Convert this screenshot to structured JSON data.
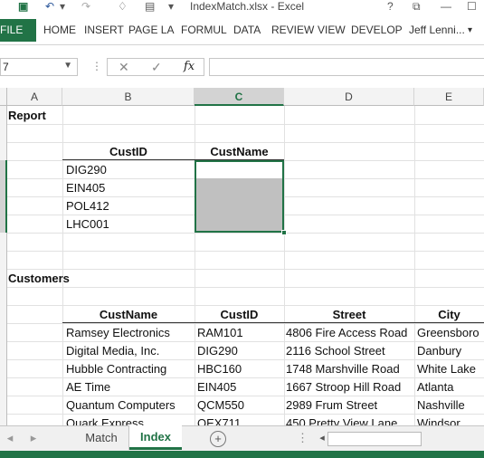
{
  "window": {
    "title": "IndexMatch.xlsx - Excel",
    "help": "?",
    "restore": "⧉",
    "minimize": "—",
    "maximize": "☐"
  },
  "ribbon": {
    "file": "FILE",
    "tabs": [
      "HOME",
      "INSERT",
      "PAGE LA",
      "FORMUL",
      "DATA",
      "REVIEW",
      "VIEW",
      "DEVELOP"
    ],
    "user": "Jeff Lenni..."
  },
  "formula_bar": {
    "name_box": "7",
    "fx": "fx",
    "value": ""
  },
  "columns": [
    "A",
    "B",
    "C",
    "D",
    "E"
  ],
  "selected_column": "C",
  "report": {
    "title": "Report",
    "header_custid": "CustID",
    "header_custname": "CustName",
    "ids": [
      "DIG290",
      "EIN405",
      "POL412",
      "LHC001"
    ]
  },
  "customers": {
    "title": "Customers",
    "headers": [
      "CustName",
      "CustID",
      "Street",
      "City"
    ],
    "rows": [
      [
        "Ramsey Electronics",
        "RAM101",
        "4806 Fire Access Road",
        "Greensboro"
      ],
      [
        "Digital Media, Inc.",
        "DIG290",
        "2116 School Street",
        "Danbury"
      ],
      [
        "Hubble Contracting",
        "HBC160",
        "1748 Marshville Road",
        "White Lake"
      ],
      [
        "AE Time",
        "EIN405",
        "1667 Stroop Hill Road",
        "Atlanta"
      ],
      [
        "Quantum Computers",
        "QCM550",
        "2989 Frum Street",
        "Nashville"
      ],
      [
        "Quark Express",
        "QEX711",
        "450 Pretty View Lane",
        "Windsor"
      ]
    ]
  },
  "sheets": {
    "tabs": [
      "Match",
      "Index"
    ],
    "active": "Index",
    "add": "+"
  },
  "colors": {
    "excel_green": "#217346",
    "header_gray": "#f3f3f3",
    "selection_fill": "#c0c0c0"
  }
}
